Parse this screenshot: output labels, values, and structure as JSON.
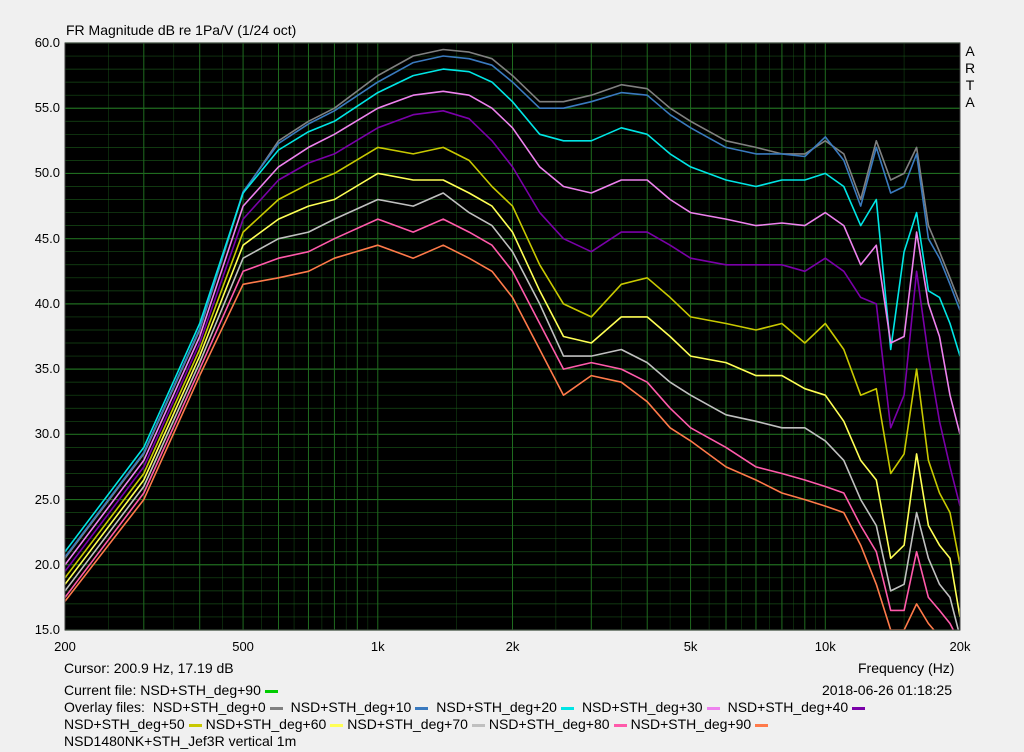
{
  "window": {
    "title": "FR Magnitude dB re 1Pa/V (1/24 oct)",
    "brand": [
      "A",
      "R",
      "T",
      "A"
    ],
    "cursor_readout": "Cursor: 200.9 Hz, 17.19 dB",
    "frequency_label": "Frequency (Hz)",
    "current_file_label": "Current file: NSD+STH_deg+90",
    "current_file_color": "#00cc00",
    "datetime": "2018-06-26  01:18:25",
    "overlay_label": "Overlay files:",
    "measurement_name": "NSD1480NK+STH_Jef3R vertical 1m"
  },
  "chart_data": {
    "type": "line",
    "title": "FR Magnitude dB re 1Pa/V (1/24 oct)",
    "xlabel": "Frequency (Hz)",
    "ylabel": "",
    "xscale": "log",
    "xlim": [
      200,
      20000
    ],
    "ylim": [
      15,
      60
    ],
    "x_ticks": [
      {
        "value": 200,
        "label": "200"
      },
      {
        "value": 500,
        "label": "500"
      },
      {
        "value": 1000,
        "label": "1k"
      },
      {
        "value": 2000,
        "label": "2k"
      },
      {
        "value": 5000,
        "label": "5k"
      },
      {
        "value": 10000,
        "label": "10k"
      },
      {
        "value": 20000,
        "label": "20k"
      }
    ],
    "y_ticks": [
      "15.0",
      "20.0",
      "25.0",
      "30.0",
      "35.0",
      "40.0",
      "45.0",
      "50.0",
      "55.0",
      "60.0"
    ],
    "grid": true,
    "legend_placement": "bottom",
    "background": "#000000",
    "grid_color": "#1f6b1f",
    "x": [
      200,
      300,
      400,
      500,
      600,
      700,
      800,
      1000,
      1200,
      1400,
      1600,
      1800,
      2000,
      2300,
      2600,
      3000,
      3500,
      4000,
      4500,
      5000,
      6000,
      7000,
      8000,
      9000,
      10000,
      11000,
      12000,
      13000,
      14000,
      15000,
      16000,
      17000,
      18000,
      19000,
      20000
    ],
    "series": [
      {
        "name": "NSD+STH_deg+0",
        "color": "#808080",
        "values": [
          20.5,
          28.5,
          38.0,
          48.5,
          52.5,
          54.0,
          55.0,
          57.5,
          59.0,
          59.5,
          59.3,
          58.8,
          57.5,
          55.5,
          55.5,
          56.0,
          56.8,
          56.5,
          55.0,
          54.0,
          52.5,
          52.0,
          51.5,
          51.5,
          52.5,
          51.5,
          48.0,
          52.5,
          49.5,
          50.0,
          52.0,
          46.0,
          44.0,
          42.0,
          40.0
        ]
      },
      {
        "name": "NSD+STH_deg+10",
        "color": "#3a7abf",
        "values": [
          20.6,
          28.6,
          38.1,
          48.6,
          52.3,
          53.8,
          54.8,
          57.0,
          58.5,
          59.0,
          58.8,
          58.3,
          57.0,
          55.0,
          55.0,
          55.5,
          56.2,
          56.0,
          54.5,
          53.5,
          52.0,
          51.5,
          51.5,
          51.3,
          52.8,
          51.0,
          47.5,
          52.0,
          48.5,
          49.0,
          51.5,
          45.0,
          43.5,
          41.5,
          39.5
        ]
      },
      {
        "name": "NSD+STH_deg+20",
        "color": "#00e5e5",
        "values": [
          21.0,
          29.0,
          38.5,
          48.5,
          51.8,
          53.2,
          54.0,
          56.2,
          57.5,
          58.0,
          57.8,
          57.0,
          55.5,
          53.0,
          52.5,
          52.5,
          53.5,
          53.0,
          51.5,
          50.5,
          49.5,
          49.0,
          49.5,
          49.5,
          50.0,
          49.0,
          46.0,
          48.0,
          36.5,
          44.0,
          47.0,
          41.0,
          40.5,
          38.5,
          36.0
        ]
      },
      {
        "name": "NSD+STH_deg+30",
        "color": "#ee82ee",
        "values": [
          20.0,
          28.0,
          37.5,
          47.5,
          50.5,
          52.0,
          53.0,
          55.0,
          56.0,
          56.3,
          56.0,
          55.0,
          53.5,
          50.5,
          49.0,
          48.5,
          49.5,
          49.5,
          48.0,
          47.0,
          46.5,
          46.0,
          46.2,
          46.0,
          47.0,
          46.0,
          43.0,
          44.5,
          37.0,
          37.5,
          45.5,
          40.0,
          37.5,
          33.0,
          30.0
        ]
      },
      {
        "name": "NSD+STH_deg+40",
        "color": "#7a00a8",
        "values": [
          19.5,
          27.5,
          37.0,
          46.5,
          49.5,
          50.8,
          51.5,
          53.5,
          54.5,
          54.8,
          54.2,
          52.5,
          50.5,
          47.0,
          45.0,
          44.0,
          45.5,
          45.5,
          44.5,
          43.5,
          43.0,
          43.0,
          43.0,
          42.5,
          43.5,
          42.5,
          40.5,
          40.0,
          30.5,
          33.0,
          42.5,
          36.0,
          31.0,
          27.5,
          24.5
        ]
      },
      {
        "name": "NSD+STH_deg+50",
        "color": "#c8c800",
        "values": [
          19.0,
          27.0,
          36.5,
          45.5,
          48.0,
          49.2,
          50.0,
          52.0,
          51.5,
          52.0,
          51.0,
          49.0,
          47.5,
          43.0,
          40.0,
          39.0,
          41.5,
          42.0,
          40.5,
          39.0,
          38.5,
          38.0,
          38.5,
          37.0,
          38.5,
          36.5,
          33.0,
          33.5,
          27.0,
          28.5,
          35.0,
          28.0,
          25.5,
          24.0,
          20.0
        ]
      },
      {
        "name": "NSD+STH_deg+60",
        "color": "#ffff55",
        "values": [
          18.5,
          26.5,
          36.0,
          44.5,
          46.5,
          47.5,
          48.0,
          50.0,
          49.5,
          49.5,
          48.5,
          47.5,
          45.5,
          41.0,
          37.5,
          37.0,
          39.0,
          39.0,
          37.5,
          36.0,
          35.5,
          34.5,
          34.5,
          33.5,
          33.0,
          31.0,
          28.0,
          26.5,
          20.5,
          21.5,
          28.5,
          23.0,
          21.5,
          20.5,
          16.0
        ]
      },
      {
        "name": "NSD+STH_deg+70",
        "color": "#c0c0c0",
        "values": [
          18.0,
          26.0,
          35.5,
          43.5,
          45.0,
          45.5,
          46.5,
          48.0,
          47.5,
          48.5,
          47.0,
          46.0,
          44.0,
          40.0,
          36.0,
          36.0,
          36.5,
          35.5,
          34.0,
          33.0,
          31.5,
          31.0,
          30.5,
          30.5,
          29.5,
          28.0,
          25.0,
          23.0,
          18.0,
          18.5,
          24.0,
          20.5,
          18.5,
          17.5,
          14.5
        ]
      },
      {
        "name": "NSD+STH_deg+80",
        "color": "#ff5aaa",
        "values": [
          17.5,
          25.5,
          35.0,
          42.5,
          43.5,
          44.0,
          45.0,
          46.5,
          45.5,
          46.5,
          45.5,
          44.5,
          42.5,
          38.5,
          35.0,
          35.5,
          35.0,
          34.0,
          32.0,
          30.5,
          29.0,
          27.5,
          27.0,
          26.5,
          26.0,
          25.5,
          23.0,
          21.0,
          16.5,
          16.5,
          21.0,
          17.5,
          16.5,
          15.5,
          14.0
        ]
      },
      {
        "name": "NSD+STH_deg+90",
        "color": "#ff7a4a",
        "values": [
          17.2,
          25.0,
          34.5,
          41.5,
          42.0,
          42.5,
          43.5,
          44.5,
          43.5,
          44.5,
          43.5,
          42.5,
          40.5,
          36.5,
          33.0,
          34.5,
          34.0,
          32.5,
          30.5,
          29.5,
          27.5,
          26.5,
          25.5,
          25.0,
          24.5,
          24.0,
          21.5,
          18.5,
          15.0,
          15.0,
          17.0,
          15.5,
          14.5,
          14.0,
          13.5
        ]
      }
    ]
  }
}
